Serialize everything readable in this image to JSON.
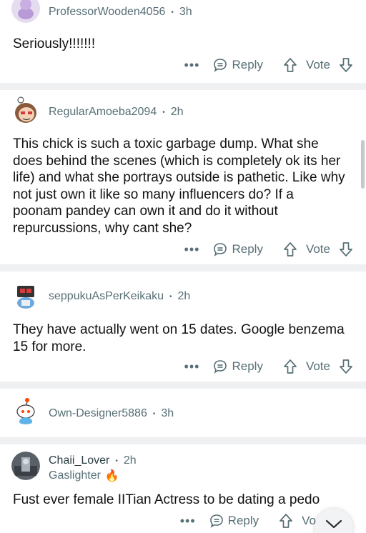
{
  "comments": [
    {
      "user": "ProfessorWooden4056",
      "time": "3h",
      "body": "Seriously!!!!!!!",
      "actions": {
        "more": "•••",
        "reply": "Reply",
        "vote": "Vote"
      }
    },
    {
      "user": "RegularAmoeba2094",
      "time": "2h",
      "body": "This chick is such a toxic garbage dump. What she does behind the scenes (which is completely ok its her life) and what she portrays outside is pathetic. Like why not just own it like so many influencers do? If a poonam pandey can own it and do it without repurcussions, why cant she?",
      "actions": {
        "more": "•••",
        "reply": "Reply",
        "vote": "Vote"
      }
    },
    {
      "user": "seppukuAsPerKeikaku",
      "time": "2h",
      "body": "They have actually went on 15 dates. Google benzema 15 for more.",
      "actions": {
        "more": "•••",
        "reply": "Reply",
        "vote": "Vote"
      }
    },
    {
      "user": "Own-Designer5886",
      "time": "3h"
    },
    {
      "user": "Chaii_Lover",
      "time": "2h",
      "flair": "Gaslighter",
      "flair_emoji": "🔥",
      "body": "Fust ever female IITian Actress to be dating a pedo",
      "actions": {
        "more": "•••",
        "reply": "Reply",
        "vote": "Vo"
      }
    }
  ],
  "separator_dot": "•"
}
